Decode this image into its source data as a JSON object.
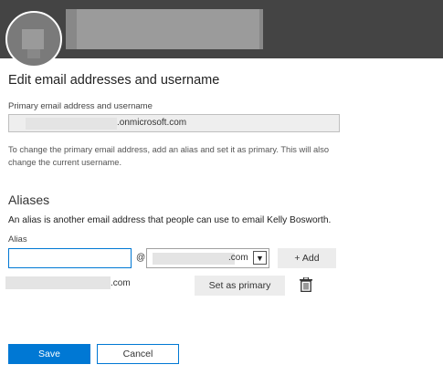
{
  "header": {
    "avatar_icon": "user-avatar"
  },
  "page": {
    "title": "Edit email addresses and username"
  },
  "primary": {
    "label": "Primary email address and username",
    "value_suffix": ".onmicrosoft.com",
    "help": "To change the primary email address, add an alias and set it as primary. This will also change the current username."
  },
  "aliases": {
    "heading": "Aliases",
    "description": "An alias is another email address that people can use to email Kelly Bosworth.",
    "alias_label": "Alias",
    "alias_value": "",
    "at_sign": "@",
    "domain_suffix": ".com",
    "add_label": "+ Add",
    "items": [
      {
        "suffix": ".com",
        "set_primary_label": "Set as primary",
        "delete_icon": "trash-icon"
      }
    ]
  },
  "footer": {
    "save_label": "Save",
    "cancel_label": "Cancel"
  },
  "colors": {
    "accent": "#0078d4",
    "header_bg": "#444444"
  }
}
